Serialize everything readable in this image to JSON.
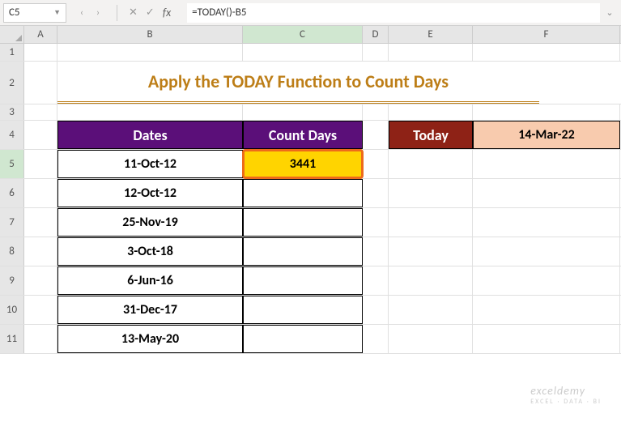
{
  "name_box": "C5",
  "formula": "=TODAY()-B5",
  "columns": [
    "A",
    "B",
    "C",
    "D",
    "E",
    "F"
  ],
  "row_numbers": [
    "1",
    "2",
    "3",
    "4",
    "5",
    "6",
    "7",
    "8",
    "9",
    "10",
    "11"
  ],
  "title": "Apply the TODAY Function to Count Days",
  "headers": {
    "dates": "Dates",
    "count_days": "Count Days"
  },
  "today_label": "Today",
  "today_value": "14-Mar-22",
  "dates": [
    "11-Oct-12",
    "12-Oct-12",
    "25-Nov-19",
    "3-Oct-18",
    "6-Jun-16",
    "31-Dec-17",
    "13-May-20"
  ],
  "count_days": [
    "3441",
    "",
    "",
    "",
    "",
    "",
    ""
  ],
  "watermark": "exceldemy",
  "watermark_sub": "EXCEL · DATA · BI"
}
